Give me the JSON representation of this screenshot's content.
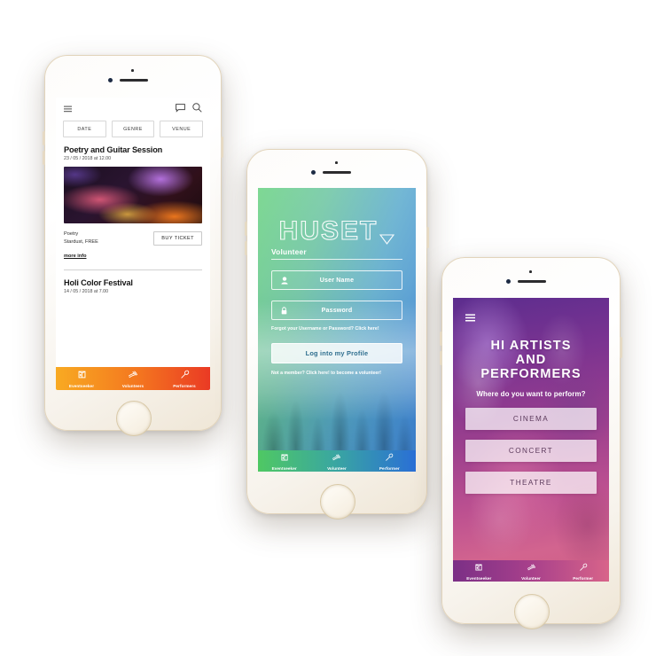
{
  "phone1": {
    "name": "eventseeker-event-list-screen",
    "header": {
      "menu_icon": "hamburger-menu-icon",
      "chat_icon": "chat-bubble-icon",
      "search_icon": "search-icon"
    },
    "filters": [
      {
        "label": "DATE"
      },
      {
        "label": "GENRE"
      },
      {
        "label": "VENUE"
      }
    ],
    "events": [
      {
        "title": "Poetry and Guitar Session",
        "date": "23 / 05 / 2018 at 12.00",
        "photo_alt": "guitar-performance-photo",
        "genre": "Poetry",
        "venue_price": "Stardust, FREE",
        "buy_label": "BUY TICKET",
        "more_label": "more info"
      },
      {
        "title": "Holi Color Festival",
        "date": "14 / 05 / 2018 at 7.00"
      }
    ],
    "nav": [
      {
        "label": "Eventseeker",
        "icon": "ticket-icon"
      },
      {
        "label": "Volunteers",
        "icon": "wings-icon"
      },
      {
        "label": "Performers",
        "icon": "microphone-icon"
      }
    ],
    "colors": {
      "nav_start": "#f8aa22",
      "nav_mid": "#f4781f",
      "nav_end": "#ea3a24"
    }
  },
  "phone2": {
    "name": "huset-volunteer-login-screen",
    "logo": "HUSET",
    "logo_mark": "downward-triangle-icon",
    "subtitle": "Volunteer",
    "username_field": {
      "placeholder": "User Name",
      "icon": "user-icon"
    },
    "password_field": {
      "placeholder": "Password",
      "icon": "lock-icon"
    },
    "forgot_link": "Forgot your Username or Password? Click here!",
    "login_button": "Log into my Profile",
    "signup_link": "Not a member? Click here! to become a volunteer!",
    "nav": [
      {
        "label": "Eventseeker",
        "icon": "ticket-icon"
      },
      {
        "label": "Volunteer",
        "icon": "wings-icon"
      },
      {
        "label": "Performer",
        "icon": "microphone-icon"
      }
    ],
    "colors": {
      "grad_start": "#6ad67e",
      "grad_end": "#3a82de"
    }
  },
  "phone3": {
    "name": "artists-performers-screen",
    "menu_icon": "hamburger-menu-icon",
    "heading_line1": "HI ARTISTS",
    "heading_line2": "AND",
    "heading_line3": "PERFORMERS",
    "question": "Where do you want to perform?",
    "options": [
      {
        "label": "CINEMA"
      },
      {
        "label": "CONCERT"
      },
      {
        "label": "THEATRE"
      }
    ],
    "nav": [
      {
        "label": "Eventseeker",
        "icon": "ticket-icon"
      },
      {
        "label": "Volunteer",
        "icon": "wings-icon"
      },
      {
        "label": "Performer",
        "icon": "microphone-icon"
      }
    ],
    "colors": {
      "grad_start": "#7b2f86",
      "grad_end": "#d8648a"
    }
  }
}
